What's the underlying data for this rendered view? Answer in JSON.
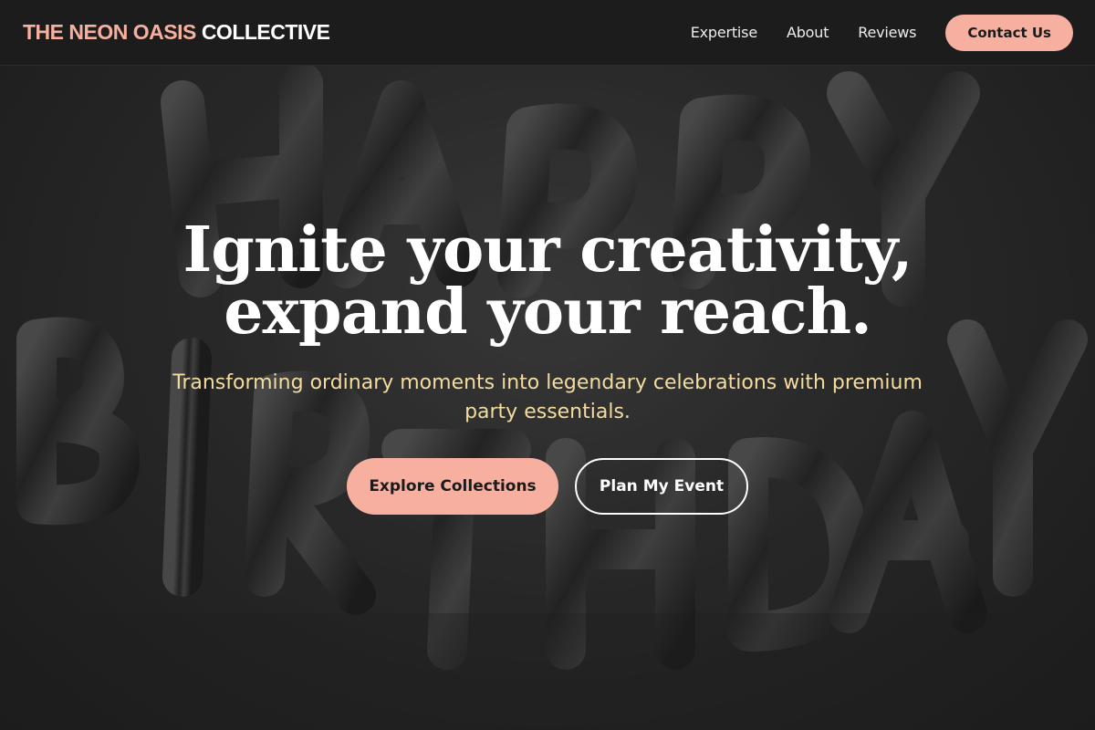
{
  "header": {
    "logo_accent": "THE NEON OASIS",
    "logo_rest": "COLLECTIVE",
    "nav": [
      {
        "label": "Expertise"
      },
      {
        "label": "About"
      },
      {
        "label": "Reviews"
      }
    ],
    "cta_label": "Contact Us"
  },
  "hero": {
    "title_line1": "Ignite your creativity,",
    "title_line2": "expand your reach.",
    "subtitle": "Transforming ordinary moments into legendary celebrations with premium party essentials.",
    "primary_button": "Explore Collections",
    "secondary_button": "Plan My Event",
    "background_image": "happy-birthday-foil-balloons"
  },
  "colors": {
    "accent": "#f7b0a0",
    "header_bg": "#1c1c1c",
    "subtitle": "#f3dc9e",
    "text": "#ffffff"
  }
}
